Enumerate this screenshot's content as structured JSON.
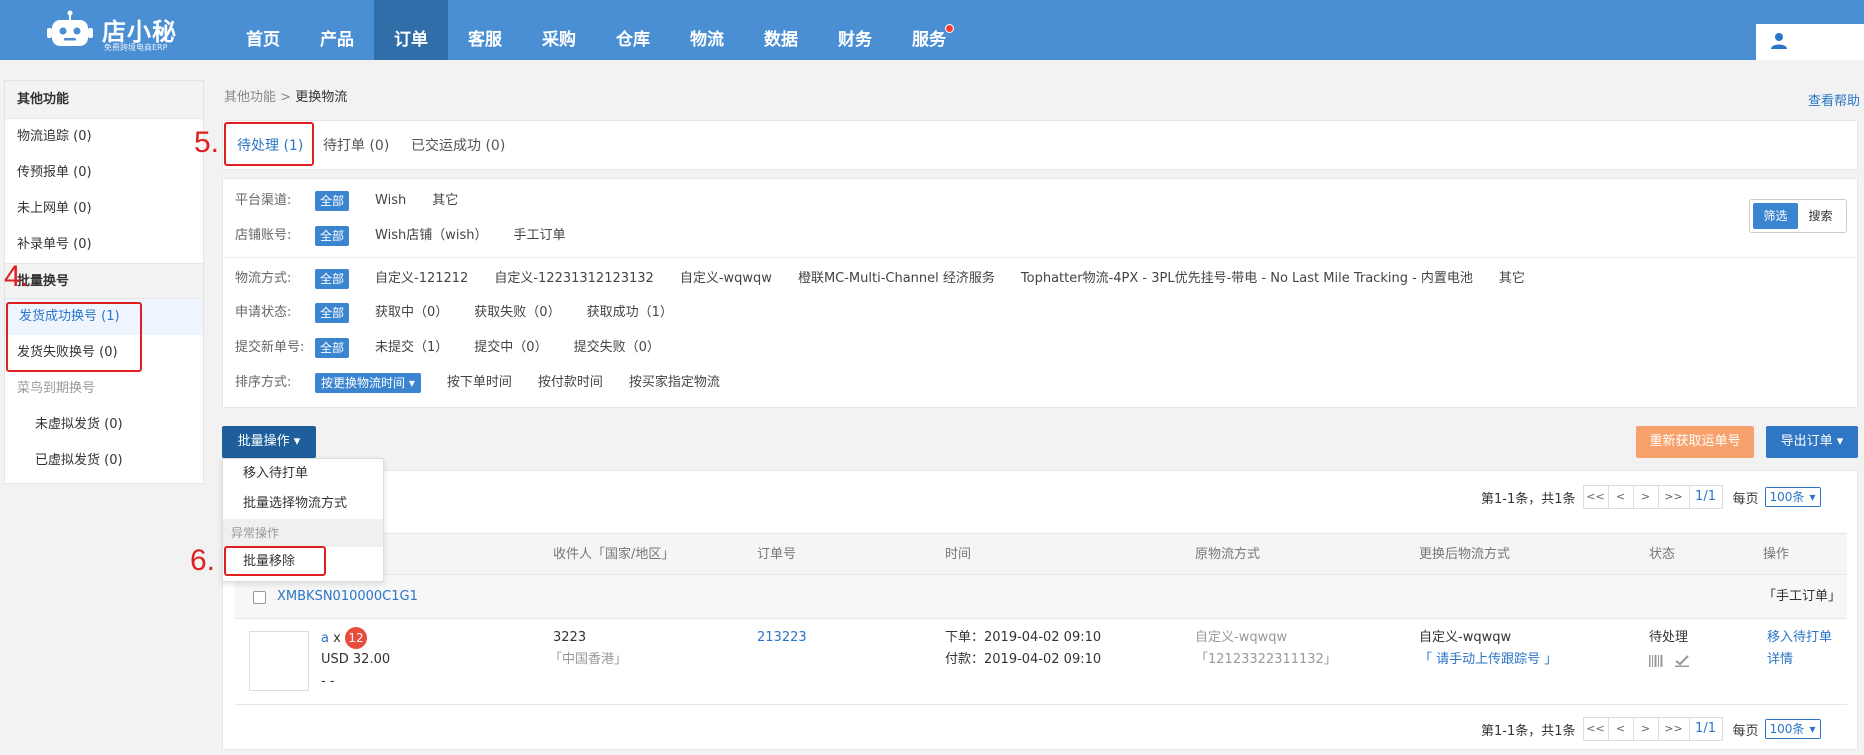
{
  "app": {
    "logo_title": "店小秘",
    "logo_subtitle": "免费跨境电商ERP"
  },
  "nav": {
    "items": [
      {
        "label": "首页"
      },
      {
        "label": "产品"
      },
      {
        "label": "订单",
        "active": true
      },
      {
        "label": "客服"
      },
      {
        "label": "采购"
      },
      {
        "label": "仓库"
      },
      {
        "label": "物流"
      },
      {
        "label": "数据"
      },
      {
        "label": "财务"
      },
      {
        "label": "服务",
        "dot": true
      }
    ]
  },
  "sidebar": {
    "section_other": "其他功能",
    "items_other": [
      "物流追踪 (0)",
      "传预报单 (0)",
      "未上网单 (0)",
      "补录单号 (0)"
    ],
    "section_batch": "批量换号",
    "items_batch": [
      "发货成功换号 (1)",
      "发货失败换号 (0)"
    ],
    "cainiao_label": "菜鸟到期换号",
    "cainiao_sub": [
      "未虚拟发货 (0)",
      "已虚拟发货 (0)"
    ]
  },
  "annotations": {
    "step4": "4.",
    "step5": "5.",
    "step6": "6."
  },
  "breadcrumb": {
    "parent": "其他功能",
    "separator": ">",
    "current": "更换物流"
  },
  "help_link": "查看帮助",
  "tabs": [
    "待处理 (1)",
    "待打单 (0)",
    "已交运成功 (0)"
  ],
  "filters": {
    "platform_label": "平台渠道:",
    "platform_options": [
      "全部",
      "Wish",
      "其它"
    ],
    "store_label": "店铺账号:",
    "store_options": [
      "全部",
      "Wish店铺（wish）",
      "手工订单"
    ],
    "logistics_label": "物流方式:",
    "logistics_options": [
      "全部",
      "自定义-121212",
      "自定义-12231312123132",
      "自定义-wqwqw",
      "橙联MC-Multi-Channel 经济服务",
      "Tophatter物流-4PX - 3PL优先挂号-带电 - No Last Mile Tracking - 内置电池",
      "其它"
    ],
    "apply_label": "申请状态:",
    "apply_options": [
      "全部",
      "获取中（0）",
      "获取失败（0）",
      "获取成功（1）"
    ],
    "submit_label": "提交新单号:",
    "submit_options": [
      "全部",
      "未提交（1）",
      "提交中（0）",
      "提交失败（0）"
    ],
    "sort_label": "排序方式:",
    "sort_options": [
      "按更换物流时间 ▾",
      "按下单时间",
      "按付款时间",
      "按买家指定物流"
    ],
    "toggle_filter": "筛选",
    "toggle_search": "搜索"
  },
  "actions": {
    "batch": "批量操作 ▾",
    "refetch": "重新获取运单号",
    "export": "导出订单 ▾"
  },
  "batch_menu": {
    "items": [
      "移入待打单",
      "批量选择物流方式"
    ],
    "group": "异常操作",
    "remove": "批量移除"
  },
  "pager": {
    "summary": "第1-1条，共1条",
    "first": "<<",
    "prev": "<",
    "next": ">",
    "last": ">>",
    "current": "1/1",
    "per_page_label": "每页",
    "per_page_value": "100条"
  },
  "table": {
    "headers": [
      "收件人「国家/地区」",
      "订单号",
      "时间",
      "原物流方式",
      "更换后物流方式",
      "状态",
      "操作"
    ],
    "group_id": "XMBKSN010000C1G1",
    "group_tag": "「手工订单」",
    "order": {
      "product_name": "a",
      "times_sign": "x",
      "qty": "12",
      "price": "USD 32.00",
      "extra": "- -",
      "recipient": "3223",
      "region": "「中国香港」",
      "order_no": "213223",
      "order_time": "下单：2019-04-02 09:10",
      "pay_time": "付款：2019-04-02 09:10",
      "orig_method": "自定义-wqwqw",
      "orig_tracking": "「12123322311132」",
      "new_method": "自定义-wqwqw",
      "new_tracking": "「 请手动上传跟踪号 」",
      "status": "待处理",
      "op_move": "移入待打单",
      "op_detail": "详情"
    }
  }
}
